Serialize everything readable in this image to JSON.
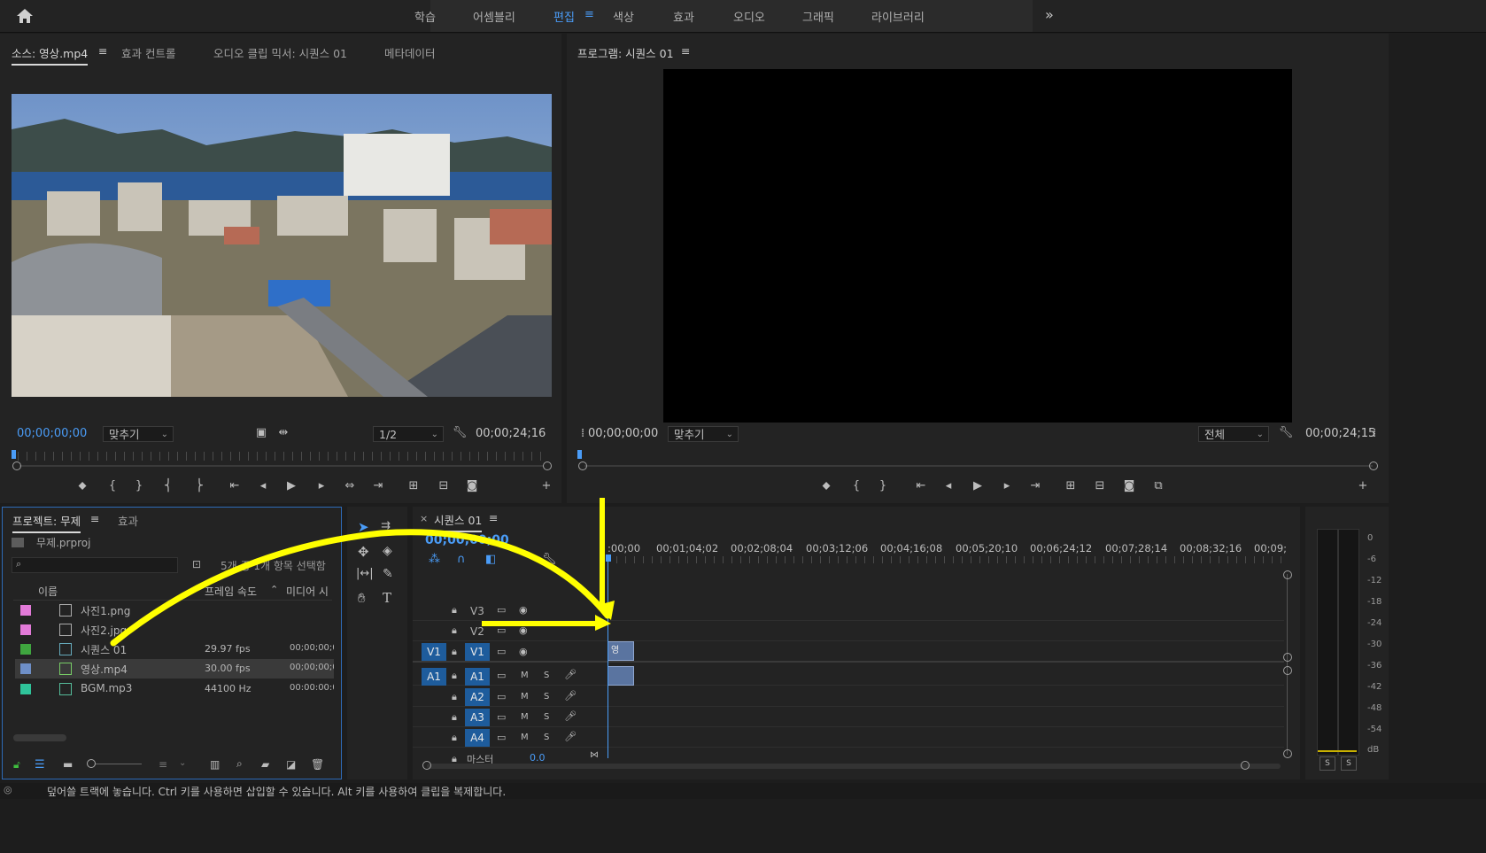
{
  "workspace": {
    "tabs": [
      "학습",
      "어셈블리",
      "편집",
      "색상",
      "효과",
      "오디오",
      "그래픽",
      "라이브러리"
    ],
    "active_tab": "편집",
    "more_label": "»"
  },
  "source_monitor": {
    "tabs": [
      "소스: 영상.mp4",
      "효과 컨트롤",
      "오디오 클립 믹서: 시퀀스 01",
      "메타데이터"
    ],
    "menu_icon": "≡",
    "timecode_in": "00;00;00;00",
    "fit_label": "맞추기",
    "resolution": "1/2",
    "timecode_out": "00;00;24;16"
  },
  "program_monitor": {
    "title": "프로그램: 시퀀스 01",
    "menu_icon": "≡",
    "timecode_in": "00;00;00;00",
    "fit_label": "맞추기",
    "resolution": "전체",
    "timecode_out": "00;00;24;15"
  },
  "project": {
    "tabs": [
      "프로젝트: 무제",
      "효과"
    ],
    "menu_icon": "≡",
    "file_name": "무제.prproj",
    "search_placeholder": "",
    "count_text": "5개 중 1개 항목 선택함",
    "columns": [
      "이름",
      "프레임 속도",
      "미디어 시"
    ],
    "items": [
      {
        "name": "사진1.png",
        "fps": "",
        "media": "",
        "color": "#e27ad8"
      },
      {
        "name": "사진2.jpg",
        "fps": "",
        "media": "",
        "color": "#e27ad8"
      },
      {
        "name": "시퀀스 01",
        "fps": "29.97 fps",
        "media": "00;00;00;0",
        "color": "#3fa63f"
      },
      {
        "name": "영상.mp4",
        "fps": "30.00 fps",
        "media": "00;00;00;0",
        "color": "#6e8fc7"
      },
      {
        "name": "BGM.mp3",
        "fps": "44100 Hz",
        "media": "00:00:00:0",
        "color": "#2fc49a"
      }
    ]
  },
  "timeline": {
    "sequence_tab": "시퀀스 01",
    "close_icon": "×",
    "menu_icon": "≡",
    "timecode": "00;00;00;00",
    "ruler_times": [
      ":00;00",
      "00;01;04;02",
      "00;02;08;04",
      "00;03;12;06",
      "00;04;16;08",
      "00;05;20;10",
      "00;06;24;12",
      "00;07;28;14",
      "00;08;32;16",
      "00;09;"
    ],
    "video_tracks": [
      "V3",
      "V2",
      "V1"
    ],
    "audio_tracks": [
      "A1",
      "A2",
      "A3",
      "A4"
    ],
    "source_patch_video": "V1",
    "source_patch_audio": "A1",
    "master_label": "마스터",
    "master_value": "0.0",
    "clip_label": "영",
    "mute_label": "M",
    "solo_label": "S"
  },
  "audio_meter": {
    "scale": [
      "0",
      "-6",
      "-12",
      "-18",
      "-24",
      "-30",
      "-36",
      "-42",
      "-48",
      "-54",
      "dB"
    ],
    "solo_labels": [
      "S",
      "S"
    ]
  },
  "status_bar": {
    "message": "덮어쓸 트랙에 놓습니다. Ctrl 키를 사용하면 삽입할 수 있습니다. Alt 키를 사용하여 클립을 복제합니다."
  },
  "colors": {
    "accent": "#4a9cf7",
    "annotation": "#ffff00",
    "track_button": "#1e5c9c",
    "clip": "#5a74a0"
  },
  "icons": [
    "home-icon",
    "wrench-icon",
    "marker-icon",
    "play-icon",
    "step-back-icon",
    "step-forward-icon",
    "camera-icon",
    "plus-icon",
    "search-icon",
    "lock-icon",
    "eye-icon",
    "mic-icon",
    "hand-icon",
    "text-icon",
    "razor-icon",
    "pen-icon",
    "selection-icon",
    "magnet-icon",
    "trash-icon",
    "folder-icon"
  ]
}
